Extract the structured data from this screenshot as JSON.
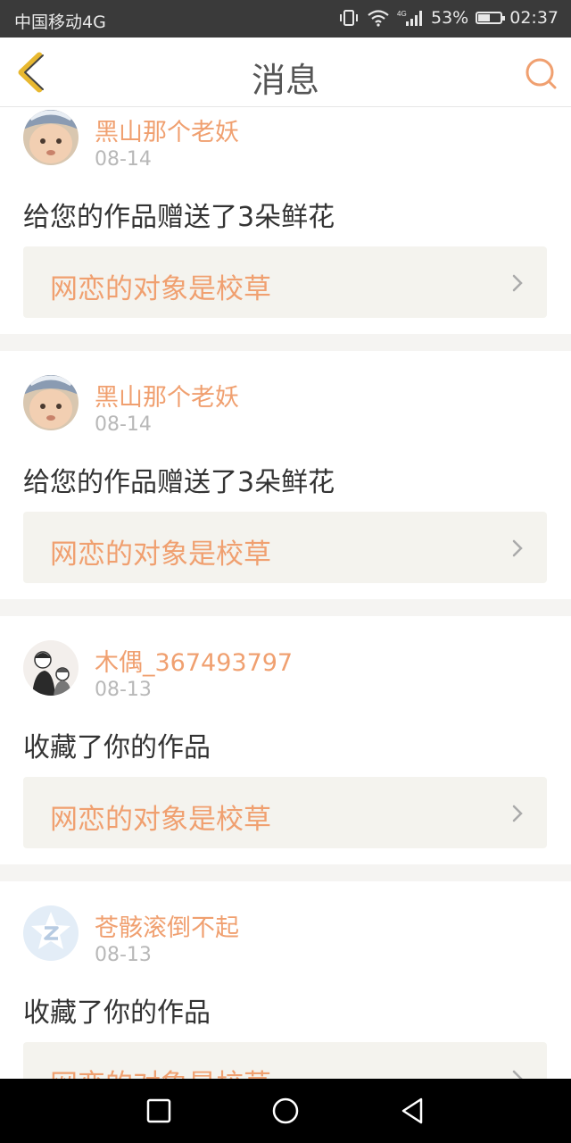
{
  "status_bar": {
    "carrier": "中国移动4G",
    "network": "4G",
    "battery": "53%",
    "battery_level": 0.53,
    "time": "02:37"
  },
  "header": {
    "title": "消息",
    "back_icon": "back-chevron-icon",
    "search_icon": "search-icon",
    "accent_color": "#f0a070"
  },
  "messages": [
    {
      "username": "黑山那个老妖",
      "date": "08-14",
      "text": "给您的作品赠送了3朵鲜花",
      "work_title": "网恋的对象是校草",
      "avatar": "baby-photo-avatar"
    },
    {
      "username": "黑山那个老妖",
      "date": "08-14",
      "text": "给您的作品赠送了3朵鲜花",
      "work_title": "网恋的对象是校草",
      "avatar": "baby-photo-avatar"
    },
    {
      "username": "木偶_367493797",
      "date": "08-13",
      "text": "收藏了你的作品",
      "work_title": "网恋的对象是校草",
      "avatar": "illustration-avatar"
    },
    {
      "username": "苍骸滚倒不起",
      "date": "08-13",
      "text": "收藏了你的作品",
      "work_title": "网恋的对象是校草",
      "avatar": "default-qq-avatar"
    }
  ],
  "system_nav": {
    "recent_icon": "square-recent-apps-icon",
    "home_icon": "circle-home-icon",
    "back_icon": "triangle-back-icon"
  }
}
